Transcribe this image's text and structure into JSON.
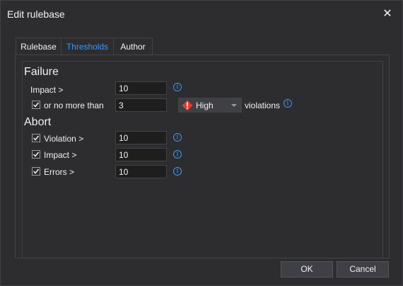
{
  "window": {
    "title": "Edit rulebase",
    "close_icon": "close-icon"
  },
  "tabs": [
    {
      "label": "Rulebase",
      "active": false
    },
    {
      "label": "Thresholds",
      "active": true
    },
    {
      "label": "Author",
      "active": false
    }
  ],
  "failure": {
    "heading": "Failure",
    "impact": {
      "label": "Impact >",
      "value": "10"
    },
    "no_more_than": {
      "label": "or no more than",
      "checked": true,
      "value": "3",
      "severity": "High",
      "suffix": "violations"
    }
  },
  "abort": {
    "heading": "Abort",
    "violation": {
      "label": "Violation >",
      "checked": true,
      "value": "10"
    },
    "impact": {
      "label": "Impact >",
      "checked": true,
      "value": "10"
    },
    "errors": {
      "label": "Errors >",
      "checked": true,
      "value": "10"
    }
  },
  "buttons": {
    "ok": "OK",
    "cancel": "Cancel"
  },
  "colors": {
    "accent": "#3399ff",
    "severity_high": "#e03c31",
    "background": "#2d2d30"
  }
}
